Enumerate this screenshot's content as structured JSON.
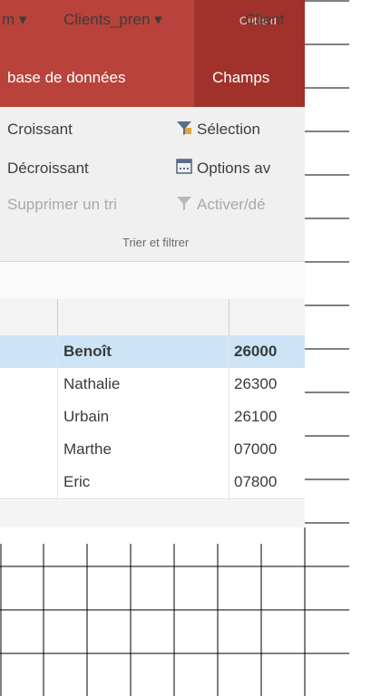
{
  "ribbon": {
    "context_title": "Outils d",
    "tabs": [
      "base de données",
      "Champs"
    ],
    "sort": {
      "ascending": "Croissant",
      "descending": "Décroissant",
      "remove": "Supprimer un tri"
    },
    "filter": {
      "selection": "Sélection",
      "advanced": "Options av",
      "toggle": "Activer/dé"
    },
    "group_label": "Trier et filtrer"
  },
  "table": {
    "headers": [
      "m",
      "Clients_pren",
      "Client"
    ],
    "rows": [
      {
        "first_name": "Benoît",
        "code": "26000",
        "selected": true
      },
      {
        "first_name": "Nathalie",
        "code": "26300",
        "selected": false
      },
      {
        "first_name": "Urbain",
        "code": "26100",
        "selected": false
      },
      {
        "first_name": "Marthe",
        "code": "07000",
        "selected": false
      },
      {
        "first_name": "Eric",
        "code": "07800",
        "selected": false
      }
    ]
  },
  "colors": {
    "ribbon": "#b9423a",
    "context": "#a0322b",
    "selection": "#cde4f7",
    "filter_icon": "#e6a23c"
  },
  "icons": [
    "sort-menu-arrow-icon",
    "funnel-icon",
    "options-icon"
  ]
}
